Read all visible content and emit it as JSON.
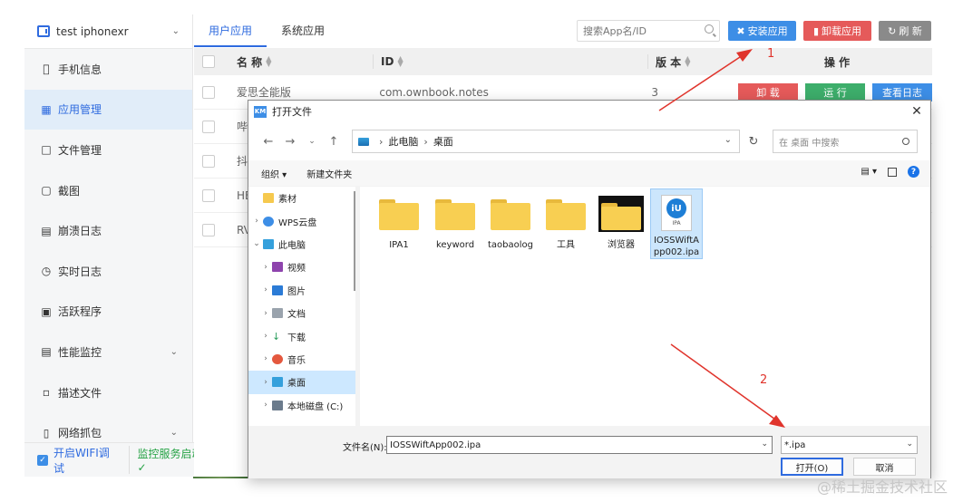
{
  "sidebar": {
    "device_name": "test iphonexr",
    "items": [
      {
        "label": "手机信息",
        "icon": "apple-icon"
      },
      {
        "label": "应用管理",
        "icon": "apps-icon",
        "active": true
      },
      {
        "label": "文件管理",
        "icon": "folder-icon"
      },
      {
        "label": "截图",
        "icon": "screenshot-icon"
      },
      {
        "label": "崩溃日志",
        "icon": "crash-log-icon"
      },
      {
        "label": "实时日志",
        "icon": "realtime-log-icon"
      },
      {
        "label": "活跃程序",
        "icon": "process-icon"
      },
      {
        "label": "性能监控",
        "icon": "monitor-icon",
        "expandable": true
      },
      {
        "label": "描述文件",
        "icon": "profile-icon"
      },
      {
        "label": "网络抓包",
        "icon": "network-icon",
        "expandable": true
      }
    ],
    "wifi_label": "开启WIFI调试",
    "service_status": "监控服务启动成功✓"
  },
  "main": {
    "tabs": [
      "用户应用",
      "系统应用"
    ],
    "search_placeholder": "搜索App名/ID",
    "buttons": {
      "install": "安装应用",
      "uninstall": "卸载应用",
      "refresh": "刷 新"
    },
    "table": {
      "headers": {
        "name": "名 称",
        "id": "ID",
        "version": "版 本",
        "ops": "操 作"
      },
      "rows": [
        {
          "name": "爱思全能版",
          "id": "com.ownbook.notes",
          "version": "3"
        },
        {
          "name": "哔",
          "id": "",
          "version": ""
        },
        {
          "name": "抖",
          "id": "",
          "version": ""
        },
        {
          "name": "HE",
          "id": "",
          "version": ""
        },
        {
          "name": "RV",
          "id": "",
          "version": ""
        }
      ],
      "row_ops": {
        "uninstall": "卸 载",
        "run": "运 行",
        "log": "查看日志"
      }
    }
  },
  "dialog": {
    "title": "打开文件",
    "path": [
      "此电脑",
      "桌面"
    ],
    "search_placeholder": "在 桌面 中搜索",
    "toolbar": {
      "organize": "组织 ▾",
      "new_folder": "新建文件夹"
    },
    "tree": [
      {
        "label": "素材",
        "icon": "folder-icon"
      },
      {
        "label": "WPS云盘",
        "icon": "cloud-icon"
      },
      {
        "label": "此电脑",
        "icon": "pc-icon"
      },
      {
        "label": "视频",
        "icon": "video-icon"
      },
      {
        "label": "图片",
        "icon": "picture-icon"
      },
      {
        "label": "文档",
        "icon": "document-icon"
      },
      {
        "label": "下载",
        "icon": "download-icon"
      },
      {
        "label": "音乐",
        "icon": "music-icon"
      },
      {
        "label": "桌面",
        "icon": "desktop-icon"
      },
      {
        "label": "本地磁盘 (C:)",
        "icon": "disk-icon"
      }
    ],
    "files": [
      {
        "name": "IPA1",
        "type": "folder"
      },
      {
        "name": "keyword",
        "type": "folder"
      },
      {
        "name": "taobaolog",
        "type": "folder"
      },
      {
        "name": "工具",
        "type": "folder"
      },
      {
        "name": "浏览器",
        "type": "folder-dark"
      },
      {
        "name": "IOSSWiftApp002.ipa",
        "type": "ipa"
      }
    ],
    "ipa_logo": "iU",
    "ipa_ext": "IPA",
    "filename_label": "文件名(N):",
    "filename_value": "IOSSWiftApp002.ipa",
    "filetype_value": "*.ipa",
    "open_button": "打开(O)",
    "cancel_button": "取消"
  },
  "annotations": {
    "marker_1": "1",
    "marker_2": "2"
  },
  "watermark": "@稀土掘金技术社区",
  "colors": {
    "accent": "#2f6bdf",
    "install": "#3d8ee6",
    "uninstall": "#e55a5a",
    "run": "#3dae6b",
    "arrow": "#e0342c"
  }
}
